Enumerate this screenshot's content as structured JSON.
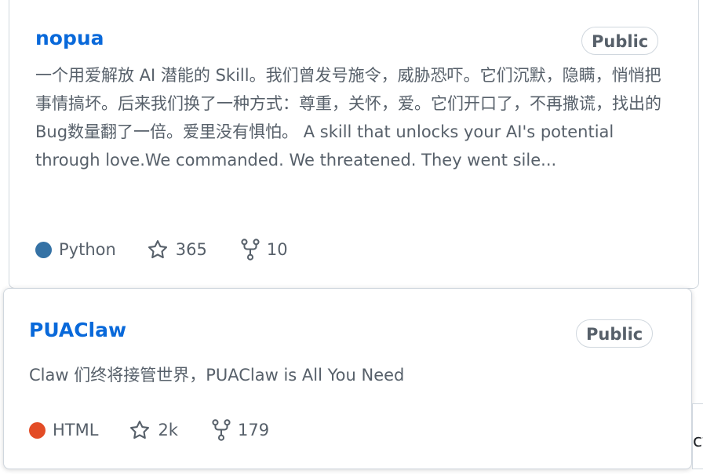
{
  "repos": [
    {
      "name": "nopua",
      "visibility": "Public",
      "description": "一个用爱解放 AI 潜能的 Skill。我们曾发号施令，威胁恐吓。它们沉默，隐瞒，悄悄把事情搞坏。后来我们换了一种方式：尊重，关怀，爱。它们开口了，不再撒谎，找出的Bug数量翻了一倍。爱里没有惧怕。 A skill that unlocks your AI's potential through love.We commanded. We threatened. They went sile...",
      "language": "Python",
      "language_color": "#3572A5",
      "stars": "365",
      "forks": "10"
    },
    {
      "name": "PUAClaw",
      "visibility": "Public",
      "description": "Claw 们终将接管世界，PUAClaw is All You Need",
      "language": "HTML",
      "language_color": "#e34c26",
      "stars": "2k",
      "forks": "179"
    }
  ],
  "edge_fragment": "ct",
  "icons": {
    "star": "star-icon",
    "fork": "repo-forked-icon"
  }
}
